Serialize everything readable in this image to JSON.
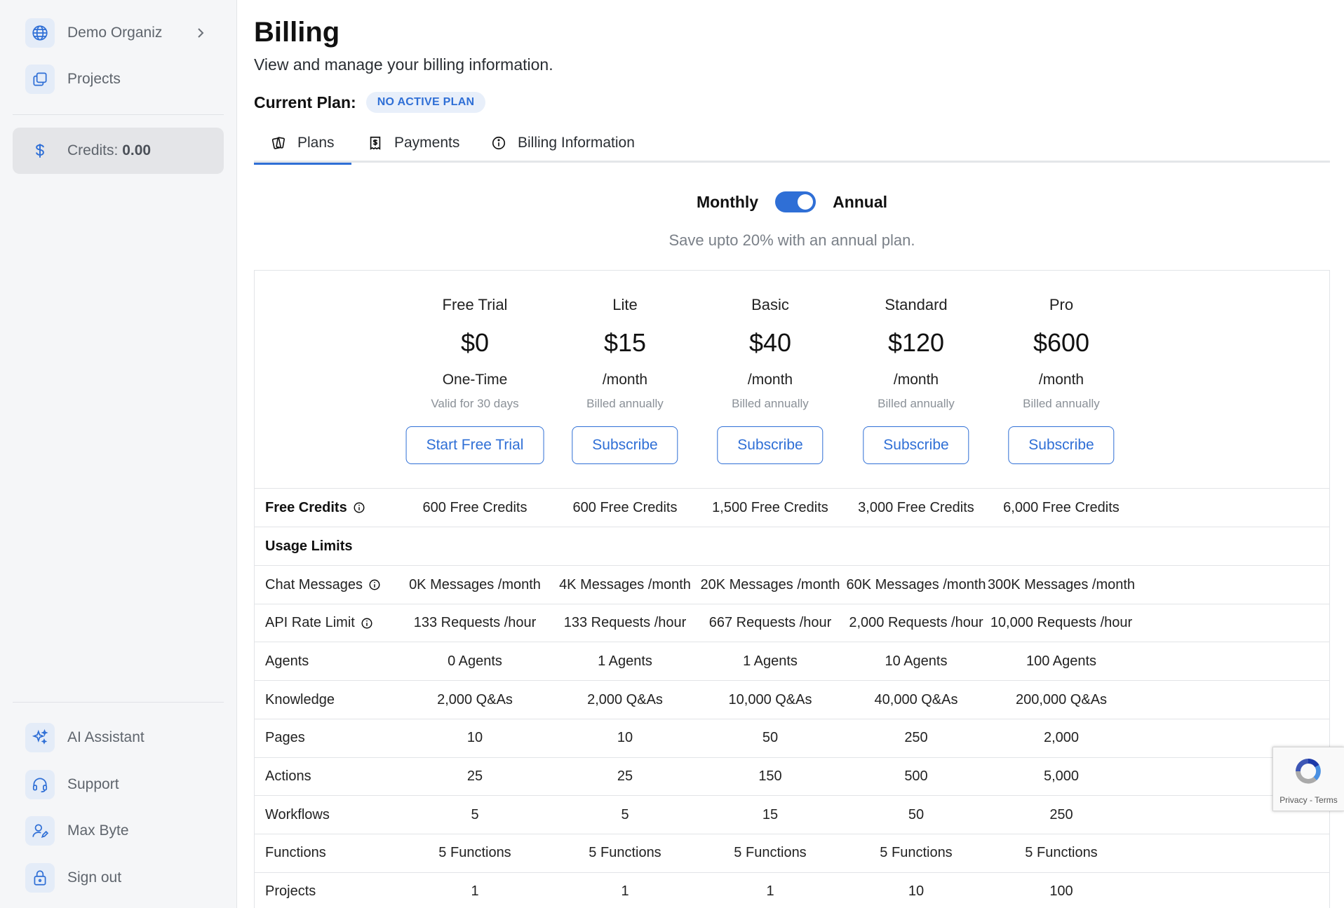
{
  "sidebar": {
    "org_name": "Demo Organiz",
    "projects_label": "Projects",
    "credits_prefix": "Credits: ",
    "credits_value": "0.00",
    "bottom_items": [
      "AI Assistant",
      "Support",
      "Max Byte",
      "Sign out"
    ]
  },
  "header": {
    "title": "Billing",
    "subtitle": "View and manage your billing information.",
    "current_plan_label": "Current Plan:",
    "current_plan_badge": "NO ACTIVE PLAN"
  },
  "tabs": [
    "Plans",
    "Payments",
    "Billing Information"
  ],
  "billing_toggle": {
    "left": "Monthly",
    "right": "Annual",
    "annual_selected": true,
    "note": "Save upto 20% with an annual plan."
  },
  "plans": [
    {
      "name": "Free Trial",
      "price": "$0",
      "period": "One-Time",
      "note": "Valid for 30 days",
      "button": "Start Free Trial"
    },
    {
      "name": "Lite",
      "price": "$15",
      "period": "/month",
      "note": "Billed annually",
      "button": "Subscribe"
    },
    {
      "name": "Basic",
      "price": "$40",
      "period": "/month",
      "note": "Billed annually",
      "button": "Subscribe"
    },
    {
      "name": "Standard",
      "price": "$120",
      "period": "/month",
      "note": "Billed annually",
      "button": "Subscribe"
    },
    {
      "name": "Pro",
      "price": "$600",
      "period": "/month",
      "note": "Billed annually",
      "button": "Subscribe"
    }
  ],
  "table": {
    "free_credits": {
      "label": "Free Credits",
      "values": [
        "600 Free Credits",
        "600 Free Credits",
        "1,500 Free Credits",
        "3,000 Free Credits",
        "6,000 Free Credits"
      ]
    },
    "usage_limits_label": "Usage Limits",
    "rows": [
      {
        "label": "Chat Messages",
        "info": true,
        "values": [
          "0K Messages /month",
          "4K Messages /month",
          "20K Messages /month",
          "60K Messages /month",
          "300K Messages /month"
        ]
      },
      {
        "label": "API Rate Limit",
        "info": true,
        "values": [
          "133 Requests /hour",
          "133 Requests /hour",
          "667 Requests /hour",
          "2,000 Requests /hour",
          "10,000 Requests /hour"
        ]
      },
      {
        "label": "Agents",
        "info": false,
        "values": [
          "0 Agents",
          "1 Agents",
          "1 Agents",
          "10 Agents",
          "100 Agents"
        ]
      },
      {
        "label": "Knowledge",
        "info": false,
        "values": [
          "2,000 Q&As",
          "2,000 Q&As",
          "10,000 Q&As",
          "40,000 Q&As",
          "200,000 Q&As"
        ]
      },
      {
        "label": "Pages",
        "info": false,
        "values": [
          "10",
          "10",
          "50",
          "250",
          "2,000"
        ]
      },
      {
        "label": "Actions",
        "info": false,
        "values": [
          "25",
          "25",
          "150",
          "500",
          "5,000"
        ]
      },
      {
        "label": "Workflows",
        "info": false,
        "values": [
          "5",
          "5",
          "15",
          "50",
          "250"
        ]
      },
      {
        "label": "Functions",
        "info": false,
        "values": [
          "5 Functions",
          "5 Functions",
          "5 Functions",
          "5 Functions",
          "5 Functions"
        ]
      },
      {
        "label": "Projects",
        "info": false,
        "values": [
          "1",
          "1",
          "1",
          "10",
          "100"
        ]
      }
    ]
  },
  "recaptcha": {
    "text": "Privacy - Terms"
  },
  "colors": {
    "accent": "#2f6fd6",
    "sidebar_bg": "#f5f6f8",
    "badge_bg": "#e8effa"
  }
}
